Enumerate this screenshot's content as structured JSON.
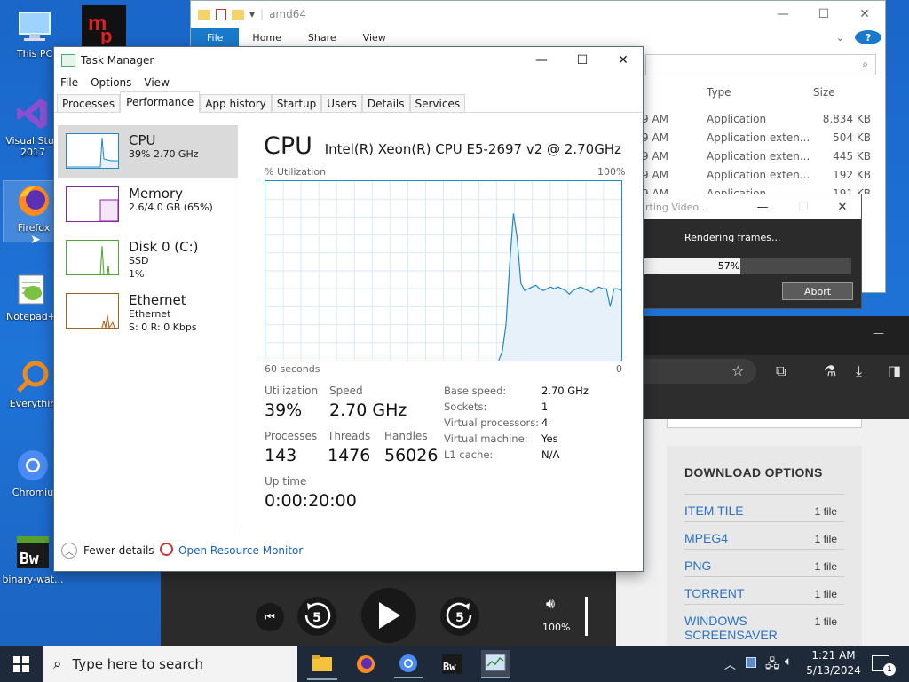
{
  "desktop": {
    "icons": [
      {
        "label": "This PC",
        "icon": "computer-icon"
      },
      {
        "label": "Visual Studio 2017",
        "line1": "Visual Stud",
        "line2": "2017",
        "icon": "visual-studio-icon"
      },
      {
        "label": "Firefox",
        "icon": "firefox-icon"
      },
      {
        "label": "Notepad+",
        "icon": "notepad-plus-icon"
      },
      {
        "label": "Everythin",
        "icon": "everything-search-icon"
      },
      {
        "label": "Chromiu",
        "icon": "chromium-icon"
      },
      {
        "label": "binary-wat...",
        "icon": "binary-watch-icon"
      }
    ]
  },
  "explorer": {
    "path": "amd64",
    "ribbon": [
      "File",
      "Home",
      "Share",
      "View"
    ],
    "headers": {
      "type": "Type",
      "size": "Size"
    },
    "rows": [
      {
        "time": "9 AM",
        "type": "Application",
        "size": "8,834 KB"
      },
      {
        "time": "9 AM",
        "type": "Application exten...",
        "size": "504 KB"
      },
      {
        "time": "9 AM",
        "type": "Application exten...",
        "size": "445 KB"
      },
      {
        "time": "9 AM",
        "type": "Application exten...",
        "size": "192 KB"
      },
      {
        "time": "9 AM",
        "type": "Application",
        "size": "191 KB"
      }
    ]
  },
  "render_dialog": {
    "title": "rting Video...",
    "message": "Rendering frames...",
    "progress": 57,
    "progress_label": "57%",
    "abort": "Abort"
  },
  "task_manager": {
    "title": "Task Manager",
    "menu": [
      "File",
      "Options",
      "View"
    ],
    "tabs": [
      "Processes",
      "Performance",
      "App history",
      "Startup",
      "Users",
      "Details",
      "Services"
    ],
    "active_tab": "Performance",
    "resources": [
      {
        "name": "CPU",
        "sub1": "39% 2.70 GHz",
        "sub2": "",
        "color": "#1f89c9"
      },
      {
        "name": "Memory",
        "sub1": "2.6/4.0 GB (65%)",
        "sub2": "",
        "color": "#8b23a6"
      },
      {
        "name": "Disk 0 (C:)",
        "sub1": "SSD",
        "sub2": "1%",
        "color": "#4ea72e"
      },
      {
        "name": "Ethernet",
        "sub1": "Ethernet",
        "sub2": "S: 0 R: 0 Kbps",
        "color": "#a7621a"
      }
    ],
    "cpu": {
      "heading": "CPU",
      "model": "Intel(R) Xeon(R) CPU E5-2697 v2 @ 2.70GHz",
      "util_label": "% Utilization",
      "util_max": "100%",
      "time_label": "60 seconds",
      "time_min": "0",
      "stats": {
        "utilization_label": "Utilization",
        "utilization": "39%",
        "speed_label": "Speed",
        "speed": "2.70 GHz",
        "processes_label": "Processes",
        "processes": "143",
        "threads_label": "Threads",
        "threads": "1476",
        "handles_label": "Handles",
        "handles": "56026",
        "uptime_label": "Up time",
        "uptime": "0:00:20:00"
      },
      "details": [
        {
          "k": "Base speed:",
          "v": "2.70 GHz"
        },
        {
          "k": "Sockets:",
          "v": "1"
        },
        {
          "k": "Virtual processors:",
          "v": "4"
        },
        {
          "k": "Virtual machine:",
          "v": "Yes"
        },
        {
          "k": "L1 cache:",
          "v": "N/A"
        }
      ],
      "graph_values": [
        0,
        0,
        0,
        0,
        0,
        0,
        0,
        0,
        0,
        0,
        0,
        0,
        0,
        0,
        0,
        0,
        0,
        0,
        0,
        0,
        0,
        0,
        0,
        0,
        0,
        0,
        0,
        0,
        0,
        0,
        0,
        0,
        0,
        0,
        0,
        0,
        0,
        0,
        0,
        0,
        0,
        0,
        0,
        0,
        0,
        0,
        0,
        0,
        0,
        0,
        0,
        0,
        0,
        0,
        0,
        0,
        0,
        0,
        0,
        0,
        0,
        0,
        0,
        0,
        0,
        0,
        0,
        0,
        0,
        0,
        0,
        0,
        0,
        0,
        0,
        0,
        0,
        0,
        0,
        0,
        0,
        0,
        0,
        0,
        0,
        0,
        0,
        0,
        0,
        0,
        0,
        0,
        0,
        0,
        0,
        0,
        0,
        0,
        0,
        0,
        0,
        0,
        0,
        0,
        0,
        0,
        0,
        0,
        0,
        0,
        0,
        0,
        0,
        0,
        0,
        0,
        0,
        0,
        0,
        0,
        0,
        0,
        0,
        0,
        0,
        0,
        0,
        0,
        0,
        0,
        0,
        0,
        0,
        0,
        0,
        0,
        0,
        0,
        0,
        0,
        0,
        0,
        0,
        0,
        0,
        0,
        0,
        0,
        0,
        0,
        0,
        0,
        0,
        0,
        0,
        0,
        0,
        0,
        0,
        0,
        0,
        0,
        0,
        0,
        0,
        0,
        0,
        0,
        0,
        0,
        0,
        0,
        0,
        0,
        0,
        0,
        0,
        0,
        0,
        0,
        0,
        0,
        0,
        0,
        0,
        0,
        0,
        0,
        0,
        0,
        0,
        0,
        0,
        0,
        0,
        0,
        0,
        0,
        0,
        0,
        0,
        0,
        0,
        0,
        0,
        0,
        0,
        0,
        0,
        0,
        0,
        0,
        0,
        0,
        0,
        0,
        0,
        0,
        0,
        0,
        0,
        0,
        0,
        0,
        0,
        0,
        0,
        0,
        0,
        0,
        0,
        0,
        0,
        0,
        0,
        0,
        0,
        0,
        0,
        0,
        0,
        0,
        0,
        0,
        0,
        0,
        0,
        0,
        0,
        0,
        0,
        0,
        0,
        0,
        0,
        0,
        0,
        0,
        0,
        0,
        0,
        0,
        0,
        0,
        0,
        0,
        0,
        0,
        0,
        0,
        0,
        0,
        0,
        0,
        0,
        0,
        0,
        0,
        0
      ]
    },
    "footer": {
      "fewer": "Fewer details",
      "monitor": "Open Resource Monitor"
    }
  },
  "cpu_series": [
    0,
    5,
    20,
    54,
    82,
    68,
    43,
    39,
    40,
    41,
    42,
    40,
    39,
    40,
    41,
    40,
    41,
    40,
    39,
    37,
    39,
    40,
    41,
    40,
    39,
    38,
    40,
    41,
    40,
    40,
    30,
    40,
    40,
    39
  ],
  "browser": {
    "download_title": "DOWNLOAD OPTIONS",
    "downloads": [
      {
        "name": "ITEM TILE",
        "count": "1 file"
      },
      {
        "name": "MPEG4",
        "count": "1 file"
      },
      {
        "name": "PNG",
        "count": "1 file"
      },
      {
        "name": "TORRENT",
        "count": "1 file"
      },
      {
        "name": "WINDOWS SCREENSAVER",
        "line1": "WINDOWS",
        "line2": "SCREENSAVER",
        "count": "1 file"
      }
    ]
  },
  "player": {
    "volume": "100%",
    "skip_back": "5",
    "skip_fwd": "5"
  },
  "taskbar": {
    "search_placeholder": "Type here to search",
    "time": "1:21 AM",
    "date": "5/13/2024",
    "notifications": "1"
  }
}
